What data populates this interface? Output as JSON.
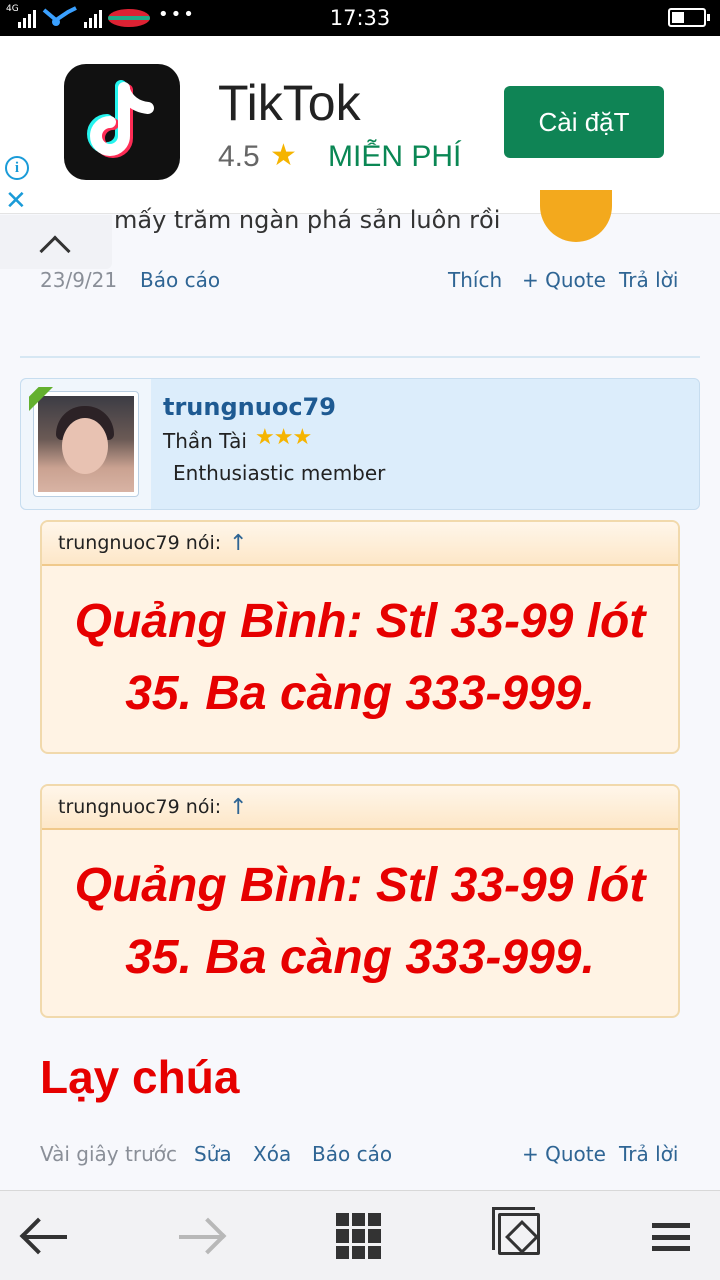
{
  "status_bar": {
    "time": "17:33",
    "network": "4G",
    "more": "•••"
  },
  "ad": {
    "app_name": "TikTok",
    "rating": "4.5",
    "price": "MIỄN PHÍ",
    "install_label": "Cài đặT",
    "info_symbol": "i",
    "close_symbol": "✕",
    "brand_color": "#0f8455"
  },
  "prev_post": {
    "truncated_text": "mấy trăm ngàn phá sản luôn rồi",
    "date": "23/9/21",
    "report": "Báo cáo",
    "like": "Thích",
    "quote": "+ Quote",
    "reply": "Trả lời"
  },
  "author": {
    "username": "trungnuoc79",
    "title": "Thần Tài",
    "stars": "★★★",
    "rank": "Enthusiastic member"
  },
  "quotes": [
    {
      "author": "trungnuoc79 nói:",
      "arrow": "↑",
      "line1": "Quảng Bình: Stl 33-99 lót",
      "line2": "35. Ba càng 333-999."
    },
    {
      "author": "trungnuoc79 nói:",
      "arrow": "↑",
      "line1": "Quảng Bình: Stl 33-99 lót",
      "line2": "35. Ba càng 333-999."
    }
  ],
  "message": "Lạy chúa",
  "post_footer": {
    "time": "Vài giây trước",
    "edit": "Sửa",
    "delete": "Xóa",
    "report": "Báo cáo",
    "quote": "+ Quote",
    "reply": "Trả lời"
  },
  "bottom_nav": [
    "back",
    "forward",
    "apps",
    "tabs",
    "menu"
  ]
}
